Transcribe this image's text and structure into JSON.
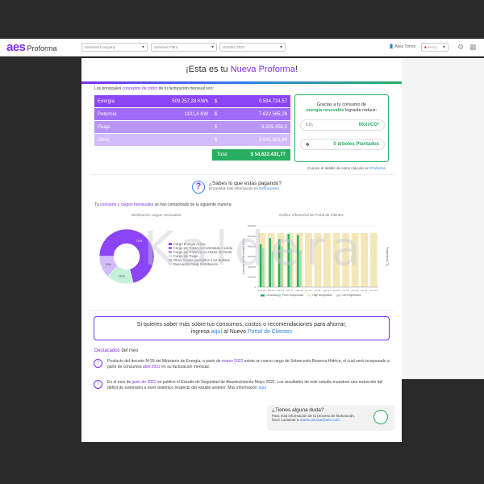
{
  "app": {
    "logo_main": "aes",
    "logo_sub": "Proforma"
  },
  "topbar": {
    "company_select": "Selected Company",
    "plant_select": "Selected Plant",
    "period_select": "Octubre 2022",
    "user_name": "Aliaz Torres",
    "country_select": "es-CL"
  },
  "banner": {
    "prefix": "¡Esta es tu ",
    "highlight": "Nueva Proforma",
    "suffix": "!"
  },
  "concepts": {
    "intro_prefix": "Los principales ",
    "intro_link": "conceptos de cobro",
    "intro_suffix": " de tu facturación mensual son:",
    "rows": [
      {
        "name": "Energía",
        "qty": "509.257,28 KWh",
        "cur": "$",
        "amount": "0.594.724,57"
      },
      {
        "name": "Potencia",
        "qty": "1101,6 KW",
        "cur": "$",
        "amount": "7.622.565,26"
      },
      {
        "name": "Peaje",
        "qty": "",
        "cur": "$",
        "amount": "8.359.458,3"
      },
      {
        "name": "Otros",
        "qty": "",
        "cur": "$",
        "amount": "8.045.683,84"
      }
    ],
    "total_label": "Total",
    "total_value": "$ 54.622.431,77"
  },
  "renewable": {
    "text_line1": "Gracias a tu consumo de",
    "text_bold": "energía renovable",
    "text_line2": " lograste reducir:",
    "co2_icon_label": "CO₂",
    "co2_value": "0ton/CO²",
    "trees_value": "0 árboles Plantados",
    "details_prefix": "Conoce el detalle de estos cálculos en ",
    "details_link": "Proforma"
  },
  "question": {
    "title": "¿Sabes lo que estás pagando?",
    "sub_prefix": "Encuentra más información en ",
    "sub_link": "Definiciones"
  },
  "monthly": {
    "prefix": "Tu ",
    "link": "consumo y cargos mensuales",
    "suffix": " se han comportado de la siguiente manera:"
  },
  "donut": {
    "title": "Distribución cargos mensuales",
    "legend": [
      {
        "label": "Cargo Energía Activa",
        "color": "#8b45f5"
      },
      {
        "label": "Cargo por Potencia Contratada o Leída",
        "color": "#a06cf7"
      },
      {
        "label": "Cargo por Potencia en Horas de Punta",
        "color": "#b994f9"
      },
      {
        "label": "Cargo por Peaje",
        "color": "#c7f0d8"
      },
      {
        "label": "Otros Costos Asociados a las Boletas",
        "color": "#d2bcfb"
      },
      {
        "label": "Descuento Peaje Distribución",
        "color": "#e9dcfd"
      }
    ],
    "slices": [
      {
        "label": "71%",
        "value": 71,
        "color": "#8b45f5"
      },
      {
        "label": "16%",
        "value": 16,
        "color": "#c7f0d8"
      },
      {
        "label": "13%",
        "value": 13,
        "color": "#d2bcfb"
      }
    ]
  },
  "chart_data": {
    "type": "bar",
    "title": "Gráfico referencial de Portal de Clientes",
    "ylabel": "Consumo de Electricidad (kWh)",
    "y2label": "Temperatura (°C)",
    "categories": [
      "ene 21",
      "feb 21",
      "mar 21",
      "abr 21",
      "may 21",
      "jun 21",
      "jul 21",
      "ago 21",
      "sep 21",
      "oct 21",
      "nov 21",
      "dic 21",
      "ene 21"
    ],
    "yticks": [
      "0",
      "100000",
      "200000",
      "300000",
      "400000",
      "500000",
      "600000"
    ],
    "ylim": [
      0,
      600000
    ],
    "series": [
      {
        "name": "Consumo",
        "color": "#27ae60",
        "values": [
          420000,
          480000,
          470000,
          520000,
          510000,
          0,
          0,
          0,
          0,
          0,
          0,
          0,
          0
        ]
      },
      {
        "name": "Prom. temperatura",
        "color": "#9be0b4",
        "values": [
          380000,
          350000,
          400000,
          380000,
          360000,
          0,
          0,
          0,
          0,
          0,
          0,
          0,
          0
        ]
      },
      {
        "name": "High temperature",
        "color": "#f3e7b8",
        "values": [
          530000,
          530000,
          530000,
          530000,
          530000,
          530000,
          530000,
          530000,
          530000,
          530000,
          530000,
          530000,
          530000
        ]
      },
      {
        "name": "Low temperature",
        "color": "#cccccc",
        "values": [
          0,
          0,
          0,
          0,
          0,
          0,
          0,
          0,
          0,
          0,
          0,
          0,
          0
        ]
      }
    ]
  },
  "portal": {
    "line1": "Si quieres saber más sobre tus consumos, costos o recomendaciones para ahorrar,",
    "line2_prefix": "ingresa ",
    "line2_link1": "aquí",
    "line2_mid": " al Nuevo ",
    "line2_link2": "Portal de Clientes"
  },
  "highlights": {
    "title_prefix": "Destacados",
    "title_suffix": " del mes",
    "items": [
      {
        "p1": "Producto del decreto Nº29 del Ministerio de Energía, a partir de ",
        "l1": "marzo 2022",
        "p2": " existe un nuevo cargo de Sobrecosto Reserva Hídrica, el cual será incorporado a partir de consumos ",
        "l2": "abril 2022",
        "p3": " en su facturación mensual."
      },
      {
        "p1": "En el mes de ",
        "l1": "junio de 2022",
        "p2": " se publicó el Estudio de Seguridad de Abastecimiento-Mayo 2022. Los resultados de este estudio muestran una reducción del déficit de suministro a nivel sistémico respecto del estudio anterior. Más información ",
        "l2": "aquí",
        "p3": ""
      }
    ]
  },
  "help": {
    "title": "¿Tienes alguna duda?",
    "line1": "Para más información de tu proceso de facturación,",
    "line2_prefix": "favor contactar a ",
    "email": "maria.carrosa@aes.com"
  },
  "watermark": "Kaldera"
}
